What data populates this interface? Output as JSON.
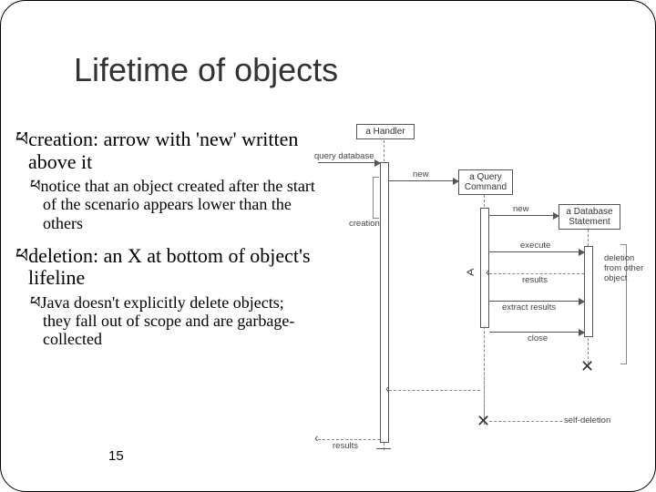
{
  "title": "Lifetime of objects",
  "bullets": {
    "creation": "creation:  arrow with 'new' written above it",
    "creation_sub": "notice that an object created after the start of the scenario appears lower than the others",
    "deletion": "deletion: an X at bottom of object's lifeline",
    "deletion_sub": "Java doesn't explicitly delete objects; they fall out of scope and are garbage-collected"
  },
  "glyph": "ཕ",
  "pagenum": "15",
  "diagram": {
    "objects": {
      "handler": "a Handler",
      "query_cmd": "a Query\nCommand",
      "db_stmt": "a Database\nStatement"
    },
    "messages": {
      "query_database": "query database",
      "new1": "new",
      "new2": "new",
      "execute": "execute",
      "results1": "results",
      "extract_results": "extract results",
      "close": "close",
      "results2": "results"
    },
    "annotations": {
      "creation": "creation",
      "deletion_other": "deletion\nfrom other\nobject",
      "self_deletion": "self-deletion"
    }
  }
}
